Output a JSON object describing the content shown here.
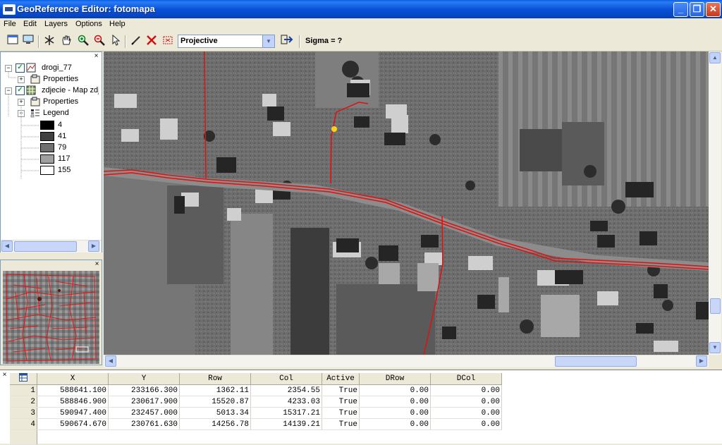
{
  "window": {
    "title": "GeoReference Editor: fotomapa",
    "minimize": "_",
    "maximize": "❐",
    "close": "✕"
  },
  "menu": [
    "File",
    "Edit",
    "Layers",
    "Options",
    "Help"
  ],
  "toolbar": {
    "method": "Projective",
    "sigma": "Sigma = ?"
  },
  "layers": {
    "items": [
      {
        "name": "drogi_77",
        "properties": "Properties"
      },
      {
        "name": "zdjecie - Map zdj",
        "properties": "Properties",
        "legend": "Legend"
      }
    ],
    "legend_values": [
      {
        "label": "4",
        "color": "#000000"
      },
      {
        "label": "41",
        "color": "#404040"
      },
      {
        "label": "79",
        "color": "#707070"
      },
      {
        "label": "117",
        "color": "#a0a0a0"
      },
      {
        "label": "155",
        "color": "#ffffff"
      }
    ]
  },
  "table": {
    "columns": [
      "X",
      "Y",
      "Row",
      "Col",
      "Active",
      "DRow",
      "DCol"
    ],
    "rows": [
      {
        "n": "1",
        "X": "588641.100",
        "Y": "233166.300",
        "Row": "1362.11",
        "Col": "2354.55",
        "Active": "True",
        "DRow": "0.00",
        "DCol": "0.00"
      },
      {
        "n": "2",
        "X": "588846.900",
        "Y": "230617.900",
        "Row": "15520.87",
        "Col": "4233.03",
        "Active": "True",
        "DRow": "0.00",
        "DCol": "0.00"
      },
      {
        "n": "3",
        "X": "590947.400",
        "Y": "232457.000",
        "Row": "5013.34",
        "Col": "15317.21",
        "Active": "True",
        "DRow": "0.00",
        "DCol": "0.00"
      },
      {
        "n": "4",
        "X": "590674.670",
        "Y": "230761.630",
        "Row": "14256.78",
        "Col": "14139.21",
        "Active": "True",
        "DRow": "0.00",
        "DCol": "0.00"
      }
    ]
  },
  "colors": {
    "road_line": "#e01010",
    "titlebar": "#0852d8",
    "gcp_marker": "#ffd21a"
  }
}
